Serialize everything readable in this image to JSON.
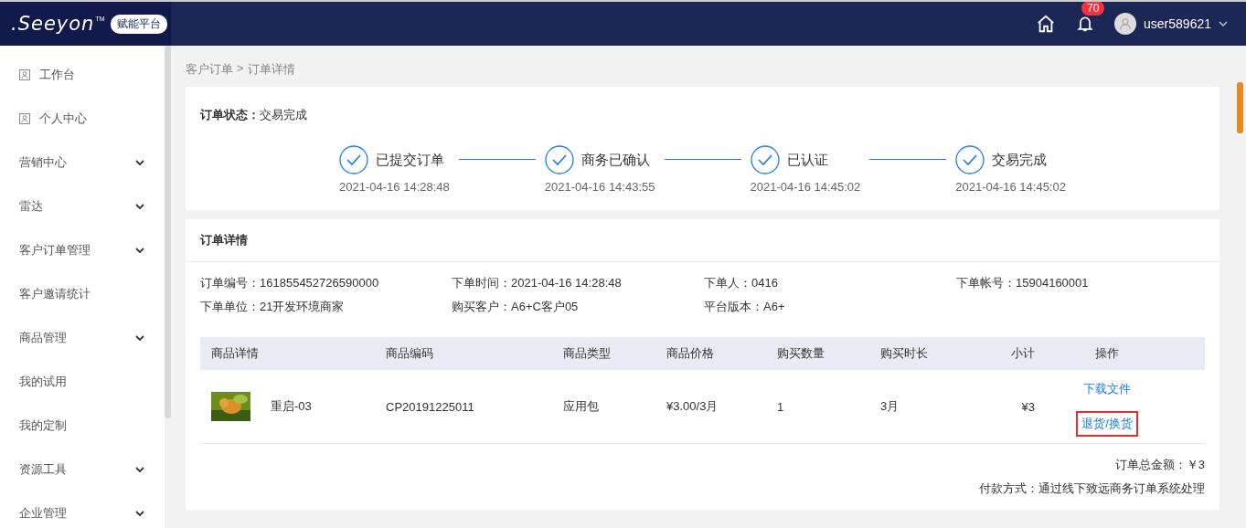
{
  "header": {
    "logo": ".Seeyon",
    "logo_mark": "TM",
    "platform_badge": "赋能平台",
    "notifications": "70",
    "user": "user589621"
  },
  "sidebar": {
    "items": [
      {
        "label": "工作台",
        "kind": "icon"
      },
      {
        "label": "个人中心",
        "kind": "icon"
      },
      {
        "label": "营销中心",
        "kind": "group"
      },
      {
        "label": "雷达",
        "kind": "group"
      },
      {
        "label": "客户订单管理",
        "kind": "group"
      },
      {
        "label": "客户邀请统计",
        "kind": "plain"
      },
      {
        "label": "商品管理",
        "kind": "group"
      },
      {
        "label": "我的试用",
        "kind": "plain"
      },
      {
        "label": "我的定制",
        "kind": "plain"
      },
      {
        "label": "资源工具",
        "kind": "group"
      },
      {
        "label": "企业管理",
        "kind": "group"
      }
    ]
  },
  "breadcrumb": [
    "客户订单",
    "订单详情"
  ],
  "breadcrumb_separator": ">",
  "status_card": {
    "label": "订单状态：",
    "value": "交易完成",
    "steps": [
      {
        "title": "已提交订单",
        "time": "2021-04-16 14:28:48",
        "done": true
      },
      {
        "title": "商务已确认",
        "time": "2021-04-16 14:43:55",
        "done": true
      },
      {
        "title": "已认证",
        "time": "2021-04-16 14:45:02",
        "done": true
      },
      {
        "title": "交易完成",
        "time": "2021-04-16 14:45:02",
        "done": true
      }
    ]
  },
  "detail_card": {
    "title": "订单详情",
    "fields": [
      {
        "label": "订单编号：",
        "value": "161855452726590000"
      },
      {
        "label": "下单时间：",
        "value": "2021-04-16 14:28:48"
      },
      {
        "label": "下单人：",
        "value": "0416"
      },
      {
        "label": "下单帐号：",
        "value": "15904160001"
      },
      {
        "label": "下单单位：",
        "value": "21开发环境商家"
      },
      {
        "label": "购买客户：",
        "value": "A6+C客户05"
      },
      {
        "label": "平台版本：",
        "value": "A6+"
      }
    ],
    "table": {
      "columns": [
        "商品详情",
        "商品编码",
        "商品类型",
        "商品价格",
        "购买数量",
        "购买时长",
        "小计",
        "操作"
      ],
      "rows": [
        {
          "name": "重启-03",
          "code": "CP20191225011",
          "type": "应用包",
          "price": "¥3.00/3月",
          "quantity": "1",
          "duration": "3月",
          "subtotal": "¥3",
          "actions": [
            {
              "label": "下载文件",
              "highlighted": false
            },
            {
              "label": "退货/换货",
              "highlighted": true
            }
          ]
        }
      ]
    },
    "total": "订单总金额：￥3",
    "payment": "付款方式：通过线下致远商务订单系统处理"
  }
}
